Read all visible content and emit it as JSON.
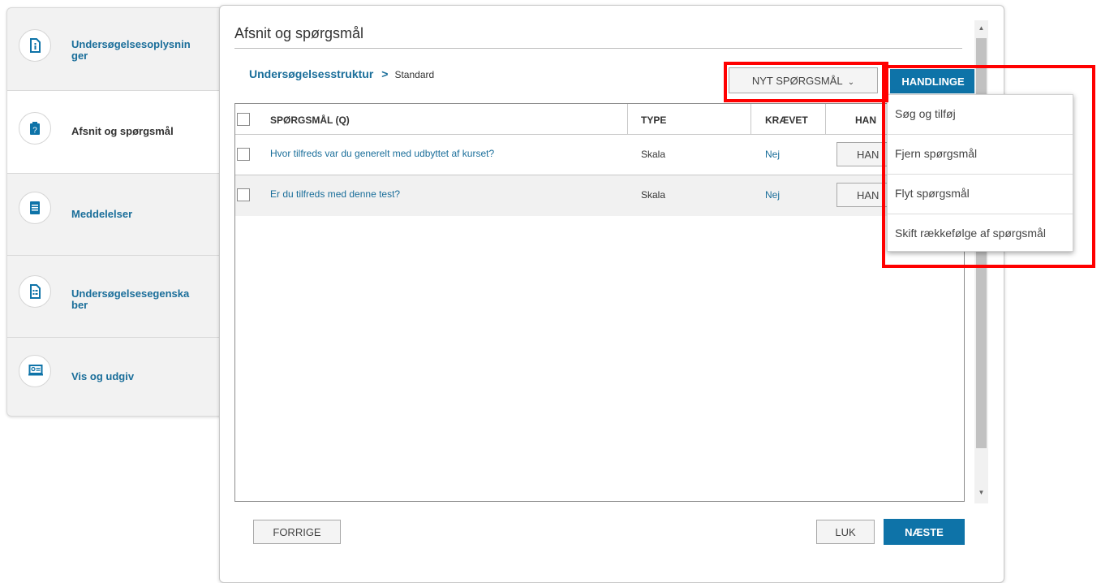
{
  "sidebar": {
    "items": [
      {
        "label": "Undersøgelsesoplysnin ger",
        "icon": "survey-info-icon"
      },
      {
        "label": "Afsnit og spørgsmål",
        "icon": "question-icon"
      },
      {
        "label": "Meddelelser",
        "icon": "messages-icon"
      },
      {
        "label": "Undersøgelsesegenska ber",
        "icon": "properties-icon"
      },
      {
        "label": "Vis og udgiv",
        "icon": "preview-publish-icon"
      }
    ]
  },
  "panel": {
    "title": "Afsnit og spørgsmål",
    "breadcrumb": {
      "link": "Undersøgelsesstruktur",
      "separator": ">",
      "current": "Standard"
    },
    "new_question_label": "NYT SPØRGSMÅL",
    "actions_label": "HANDLINGE"
  },
  "table": {
    "headers": {
      "question": "SPØRGSMÅL (Q)",
      "type": "TYPE",
      "required": "KRÆVET",
      "actions": "HAN"
    },
    "rows": [
      {
        "question": "Hvor tilfreds var du generelt med udbyttet af kurset?",
        "type": "Skala",
        "required": "Nej",
        "action": "HAN"
      },
      {
        "question": "Er du tilfreds med denne test?",
        "type": "Skala",
        "required": "Nej",
        "action": "HAN"
      }
    ]
  },
  "menu": {
    "items": [
      "Søg og tilføj",
      "Fjern spørgsmål",
      "Flyt spørgsmål",
      "Skift rækkefølge af spørgsmål"
    ]
  },
  "footer": {
    "previous": "FORRIGE",
    "close": "LUK",
    "next": "NÆSTE"
  },
  "colors": {
    "accent": "#0e73a8",
    "link": "#1a6e9a",
    "highlight": "#ff0000"
  }
}
